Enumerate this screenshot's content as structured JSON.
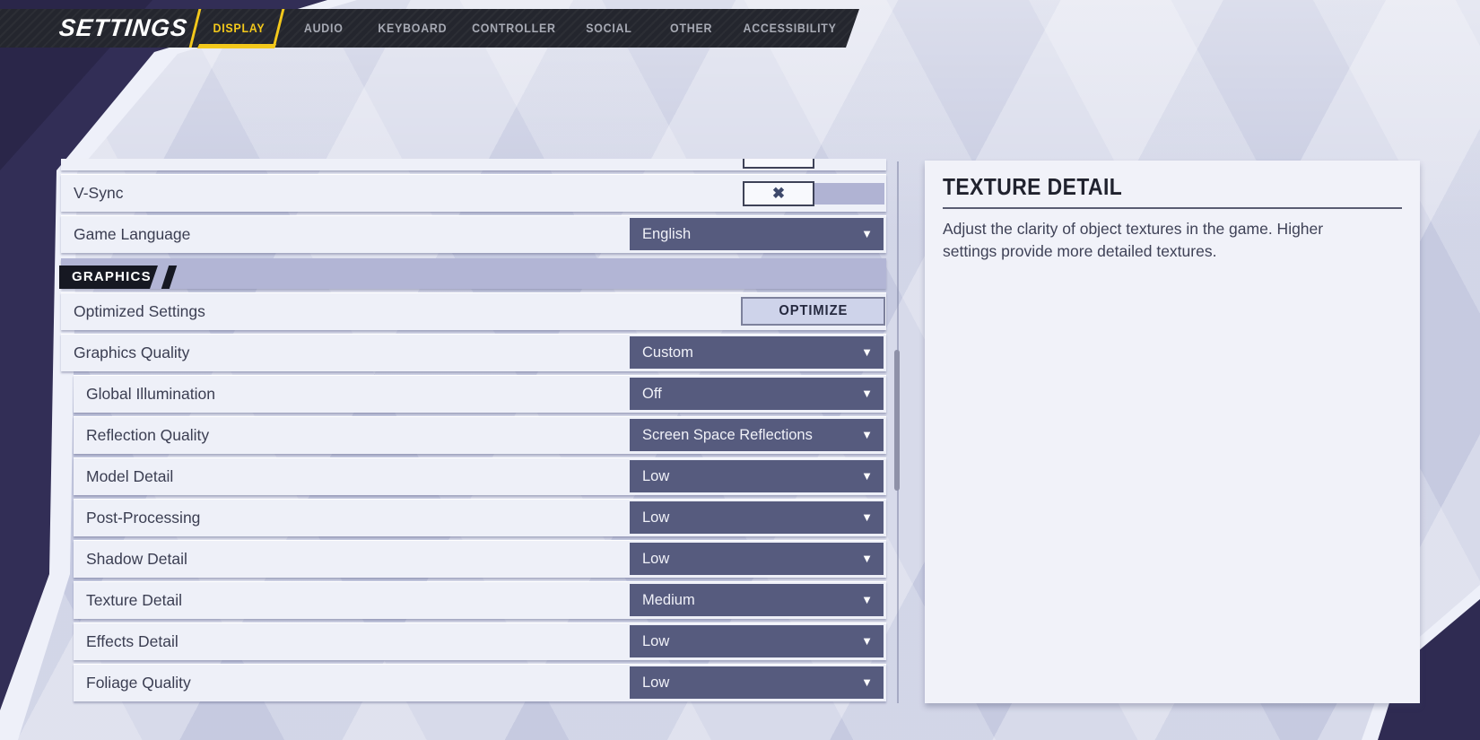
{
  "header": {
    "title": "SETTINGS",
    "tabs": [
      {
        "label": "DISPLAY",
        "active": true
      },
      {
        "label": "AUDIO",
        "active": false
      },
      {
        "label": "KEYBOARD",
        "active": false
      },
      {
        "label": "CONTROLLER",
        "active": false
      },
      {
        "label": "SOCIAL",
        "active": false
      },
      {
        "label": "OTHER",
        "active": false
      },
      {
        "label": "ACCESSIBILITY",
        "active": false
      }
    ]
  },
  "settings_panel": {
    "section_label": "GRAPHICS",
    "rows": [
      {
        "label": "V-Sync",
        "type": "toggle",
        "state": "on"
      },
      {
        "label": "Game Language",
        "type": "dropdown",
        "value": "English"
      },
      {
        "label": "Optimized Settings",
        "type": "button",
        "button_label": "OPTIMIZE"
      },
      {
        "label": "Graphics Quality",
        "type": "dropdown",
        "value": "Custom"
      },
      {
        "label": "Global Illumination",
        "type": "dropdown",
        "value": "Off",
        "indent": true
      },
      {
        "label": "Reflection Quality",
        "type": "dropdown",
        "value": "Screen Space Reflections",
        "indent": true
      },
      {
        "label": "Model Detail",
        "type": "dropdown",
        "value": "Low",
        "indent": true
      },
      {
        "label": "Post-Processing",
        "type": "dropdown",
        "value": "Low",
        "indent": true
      },
      {
        "label": "Shadow Detail",
        "type": "dropdown",
        "value": "Low",
        "indent": true
      },
      {
        "label": "Texture Detail",
        "type": "dropdown",
        "value": "Medium",
        "indent": true
      },
      {
        "label": "Effects Detail",
        "type": "dropdown",
        "value": "Low",
        "indent": true
      },
      {
        "label": "Foliage Quality",
        "type": "dropdown",
        "value": "Low",
        "indent": true
      }
    ]
  },
  "detail_panel": {
    "title": "TEXTURE DETAIL",
    "description": "Adjust the clarity of object textures in the game. Higher settings provide more detailed textures."
  },
  "icons": {
    "dropdown_arrow": "▼",
    "toggle_x": "✖"
  },
  "colors": {
    "accent_yellow": "#f3c81b",
    "topbar_dark": "#24262e",
    "dropdown_bg": "#565b7e",
    "row_bg": "#eef0f8",
    "section_band": "#b2b5d5",
    "badge_dark": "#161822",
    "panel_bg": "#f1f2f9",
    "corner_dark": "#322e56",
    "label_text": "#3b3e52"
  }
}
